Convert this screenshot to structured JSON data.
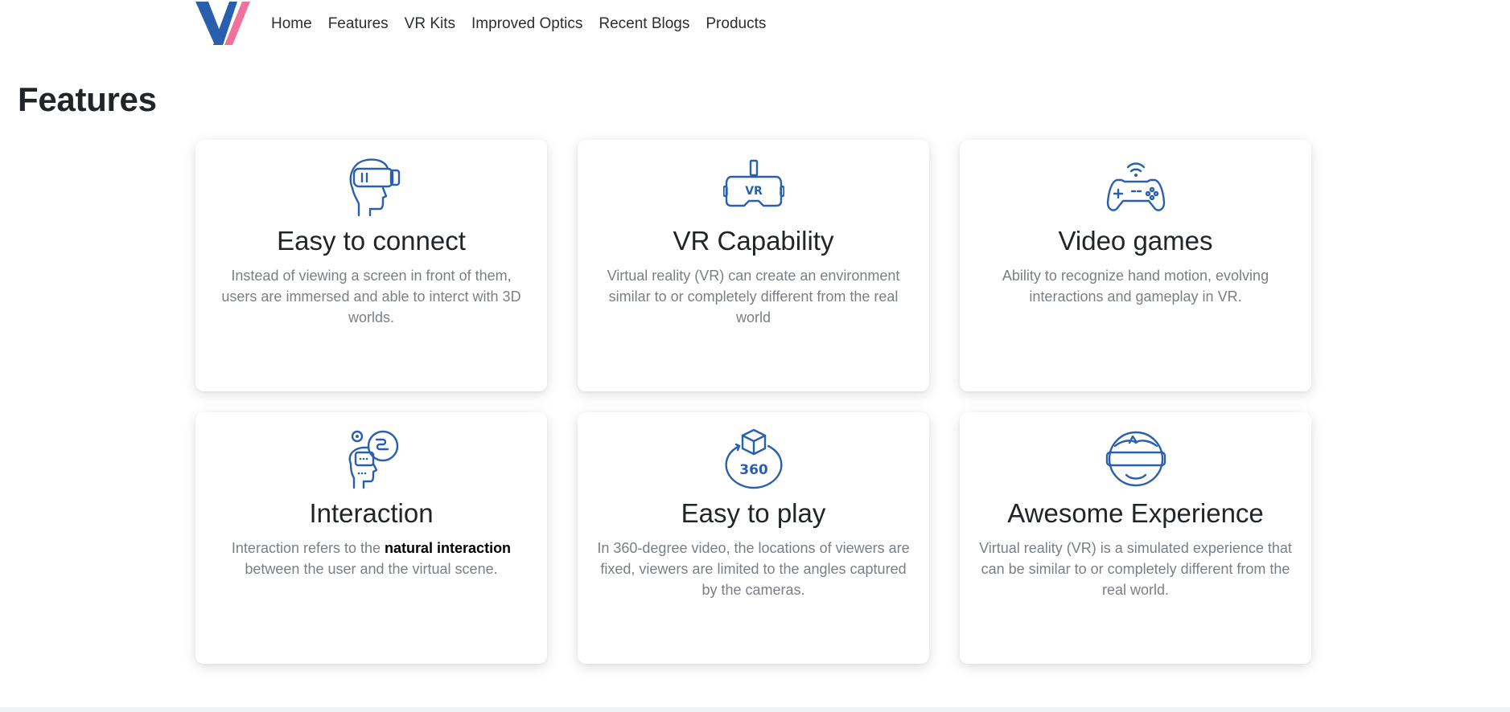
{
  "nav": {
    "logo_colors": {
      "primary": "#2a5fb0",
      "accent": "#f0729b"
    },
    "links": [
      "Home",
      "Features",
      "VR Kits",
      "Improved Optics",
      "Recent Blogs",
      "Products"
    ]
  },
  "section": {
    "title": "Features"
  },
  "cards": [
    {
      "icon": "vr-head-icon",
      "title": "Easy to connect",
      "text": "Instead of viewing a screen in front of them, users are immersed and able to interct with 3D worlds."
    },
    {
      "icon": "vr-headset-icon",
      "icon_label": "VR",
      "title": "VR Capability",
      "text": "Virtual reality (VR) can create an environment similar to or completely different from the real world"
    },
    {
      "icon": "gamepad-icon",
      "title": "Video games",
      "text": "Ability to recognize hand motion, evolving interactions and gameplay in VR."
    },
    {
      "icon": "interaction-icon",
      "title": "Interaction",
      "text_before": "Interaction refers to the ",
      "text_bold": "natural interaction",
      "text_after": " between the user and the virtual scene."
    },
    {
      "icon": "cube-360-icon",
      "icon_label": "360",
      "title": "Easy to play",
      "text": "In 360-degree video, the locations of viewers are fixed, viewers are limited to the angles captured by the cameras."
    },
    {
      "icon": "vr-face-icon",
      "title": "Awesome Experience",
      "text": "Virtual reality (VR) is a simulated experience that can be similar to or completely different from the real world."
    }
  ]
}
